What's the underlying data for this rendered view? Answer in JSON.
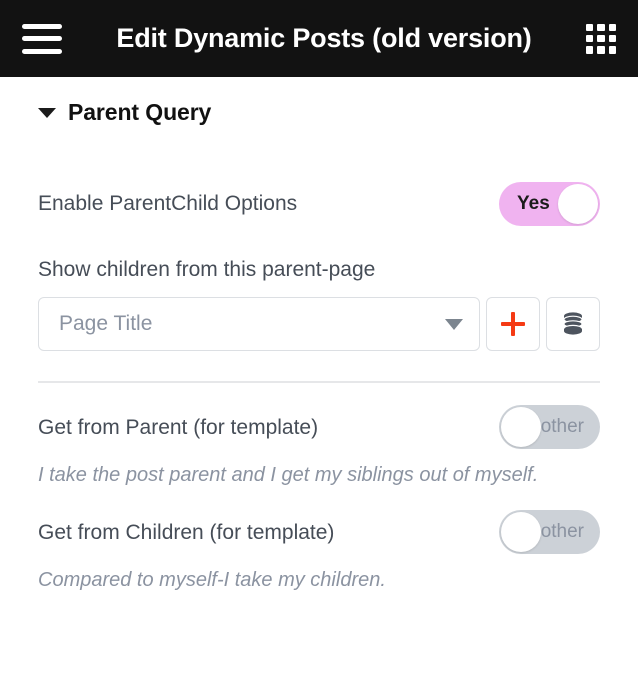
{
  "appbar": {
    "menu_icon": "hamburger-menu-icon",
    "title": "Edit Dynamic Posts (old version)",
    "apps_icon": "apps-grid-icon",
    "background": "#121212"
  },
  "section": {
    "title": "Parent Query",
    "expanded": true,
    "caret_icon": "triangle-down-icon"
  },
  "fields": {
    "enable_parent_child": {
      "label": "Enable ParentChild Options",
      "toggle_state": "on",
      "toggle_label": "Yes",
      "track_color": "#f0b3f0"
    },
    "parent_page": {
      "label": "Show children from this parent-page",
      "select_value": "Page Title",
      "select_caret_icon": "chevron-down-icon",
      "add_button_icon": "plus-icon",
      "add_button_color": "#f53a14",
      "database_button_icon": "database-icon"
    },
    "get_from_parent": {
      "label": "Get from Parent (for template)",
      "toggle_state": "off",
      "toggle_label": "other",
      "track_color": "#ccd1d7",
      "hint": "I take the post parent and I get my siblings out of myself."
    },
    "get_from_children": {
      "label": "Get from Children (for template)",
      "toggle_state": "off",
      "toggle_label": "other",
      "track_color": "#ccd1d7",
      "hint": "Compared to myself-I take my children."
    }
  }
}
